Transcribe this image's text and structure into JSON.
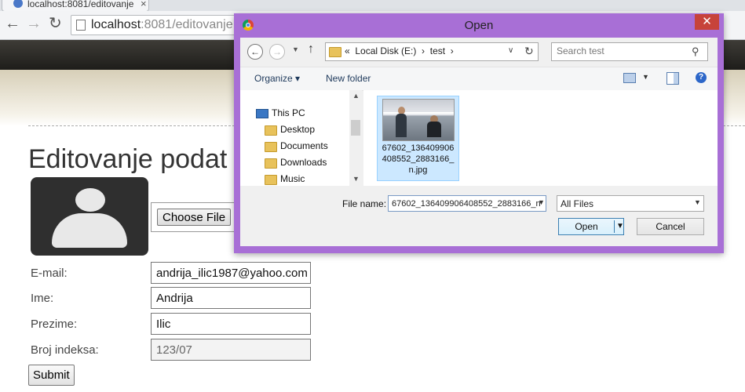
{
  "browser": {
    "tab_title": "localhost:8081/editovanje",
    "tab_close": "×",
    "address_host": "localhost",
    "address_rest": ":8081/editovanje"
  },
  "page": {
    "title": "Editovanje podat",
    "choose_file": "Choose File",
    "fields": [
      {
        "label": "E-mail:",
        "value": "andrija_ilic1987@yahoo.com"
      },
      {
        "label": "Ime:",
        "value": "Andrija"
      },
      {
        "label": "Prezime:",
        "value": "Ilic"
      },
      {
        "label": "Broj indeksa:",
        "value": "123/07"
      }
    ],
    "submit": "Submit"
  },
  "dialog": {
    "title": "Open",
    "close": "✕",
    "path_prefix": "«",
    "path_drive": "Local Disk (E:)",
    "path_folder": "test",
    "search_placeholder": "Search test",
    "organize": "Organize",
    "new_folder": "New folder",
    "nav_items": [
      "This PC",
      "Desktop",
      "Documents",
      "Downloads",
      "Music"
    ],
    "file_name_display": "67602_136409906408552_2883166_n.jpg",
    "file_name_label": "File name:",
    "file_name_value": "67602_136409906408552_2883166_n",
    "file_type": "All Files",
    "open_button": "Open",
    "cancel_button": "Cancel",
    "help": "?"
  }
}
